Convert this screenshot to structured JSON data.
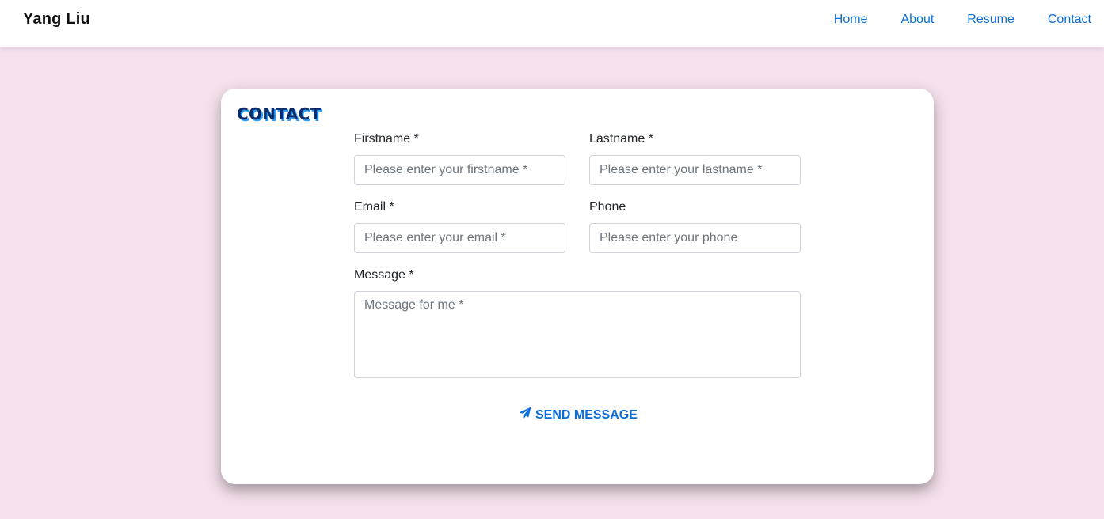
{
  "nav": {
    "brand": "Yang Liu",
    "links": [
      "Home",
      "About",
      "Resume",
      "Contact"
    ]
  },
  "contact": {
    "title": "CONTACT",
    "firstname": {
      "label": "Firstname *",
      "placeholder": "Please enter your firstname *"
    },
    "lastname": {
      "label": "Lastname *",
      "placeholder": "Please enter your lastname *"
    },
    "email": {
      "label": "Email *",
      "placeholder": "Please enter your email *"
    },
    "phone": {
      "label": "Phone",
      "placeholder": "Please enter your phone"
    },
    "message": {
      "label": "Message *",
      "placeholder": "Message for me *"
    },
    "send_label": "SEND MESSAGE",
    "send_icon": "paper-plane-icon"
  },
  "colors": {
    "background": "#f5e1ee",
    "link": "#0b6edb",
    "title": "#0a2b6b",
    "title_shadow": "#2f9cf5"
  }
}
